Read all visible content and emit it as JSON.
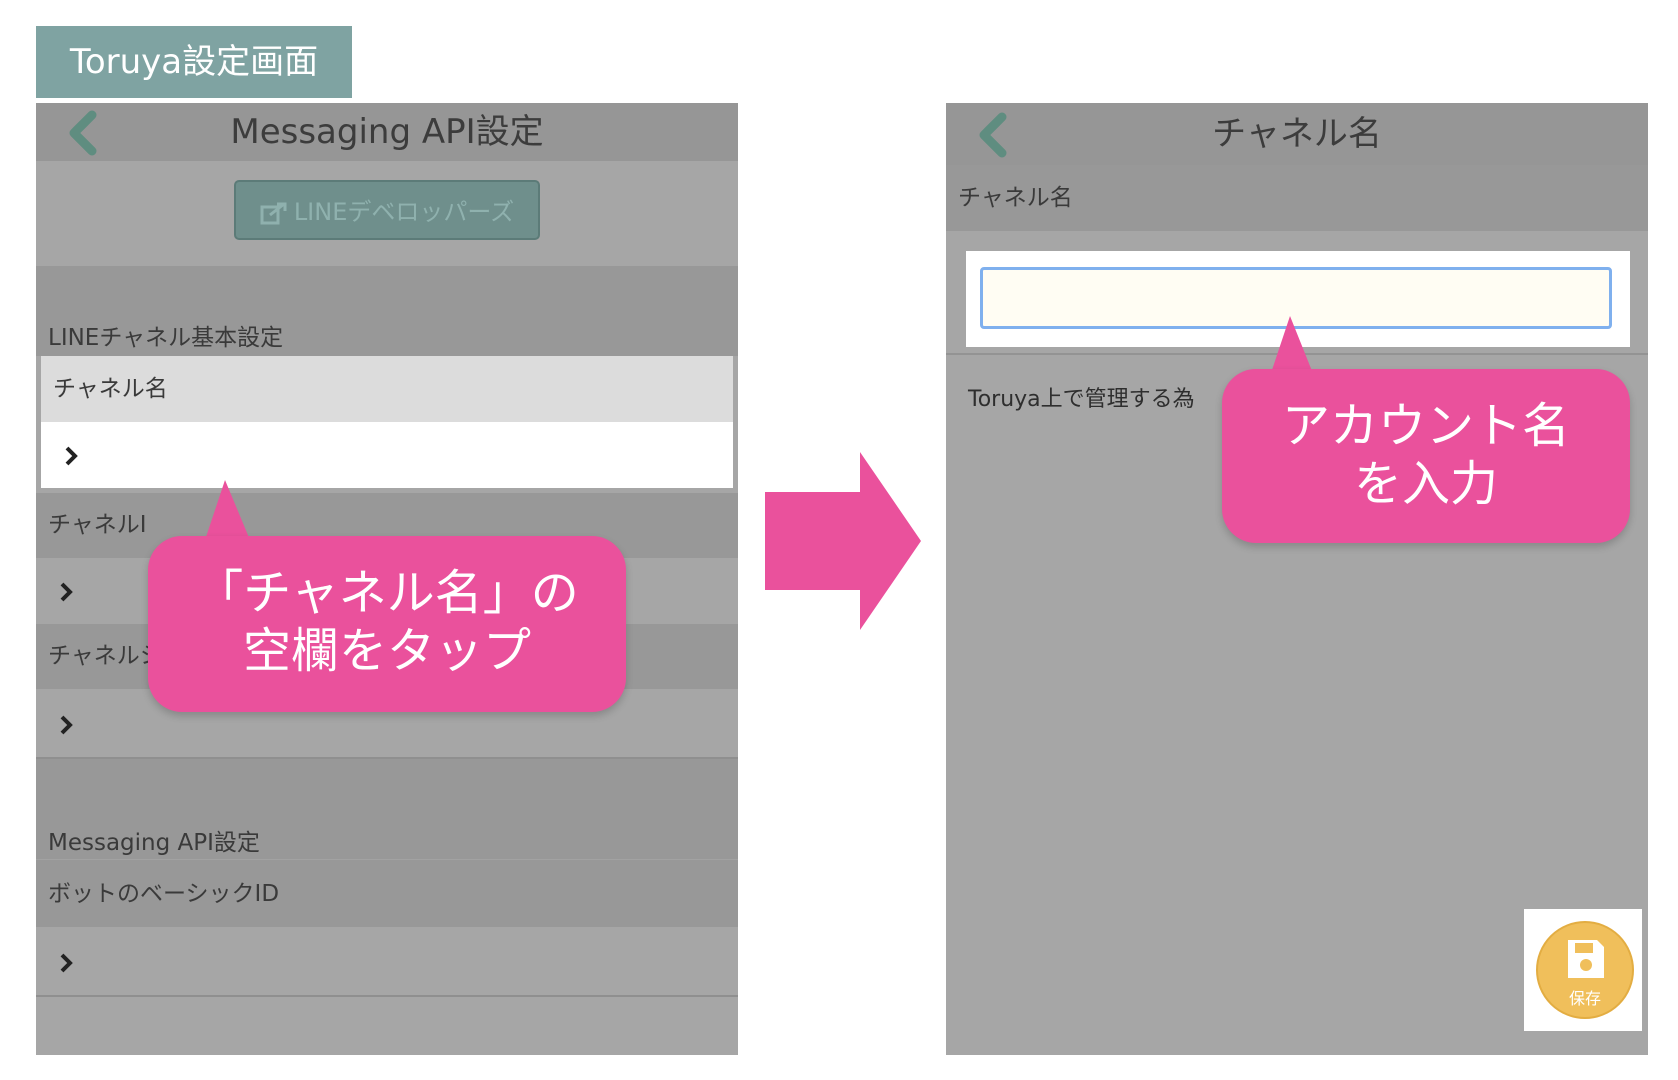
{
  "header": {
    "tag": "Toruya設定画面"
  },
  "left": {
    "nav_title": "Messaging API設定",
    "line_dev_button": "LINEデベロッパーズ",
    "section1_header": "LINEチャネル基本設定",
    "row_channel_name_label": "チャネル名",
    "row_channel_id_label_partial": "チャネルI",
    "row_channel_secret_label_partial": "チャネルシ",
    "section2_header": "Messaging API設定",
    "row_bot_basic_id_label": "ボットのベーシックID"
  },
  "callout_left": {
    "line1": "「チャネル名」の",
    "line2": "空欄をタップ"
  },
  "right": {
    "nav_title": "チャネル名",
    "field_label": "チャネル名",
    "input_value": "",
    "helper_text_partial": "Toruya上で管理する為",
    "save_label": "保存"
  },
  "callout_right": {
    "line1": "アカウント名",
    "line2": "を入力"
  },
  "icons": {
    "back": "chevron-left-icon",
    "row_arrow": "chevron-right-icon",
    "external": "external-link-icon",
    "save": "floppy-disk-icon",
    "arrow": "right-arrow-icon"
  },
  "colors": {
    "accent_pink": "#ea519c",
    "tag_teal": "#7fa3a2",
    "save_orange": "#f0bf5b",
    "back_green": "#5f8d80"
  }
}
